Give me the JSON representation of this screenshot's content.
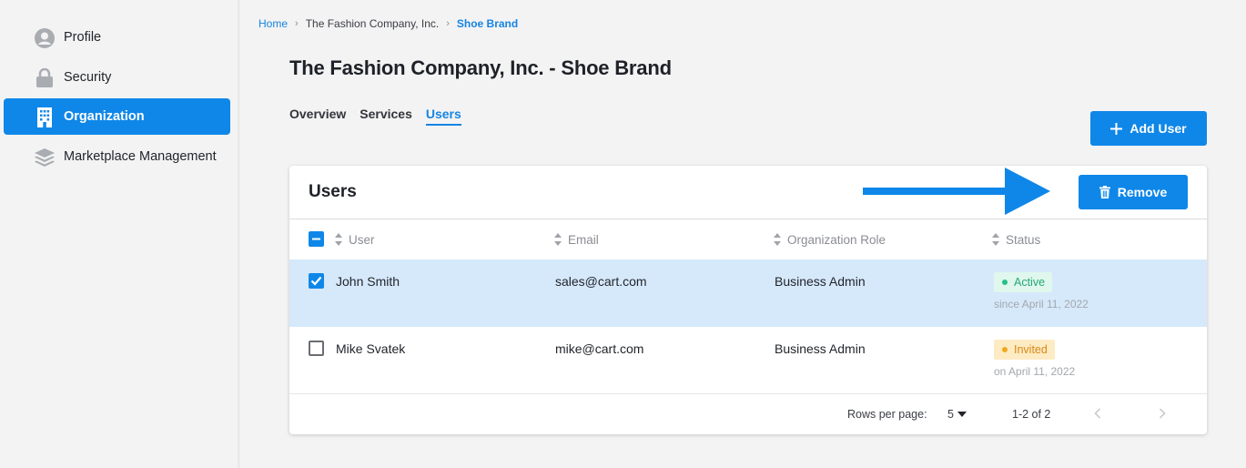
{
  "sidebar": {
    "items": [
      {
        "label": "Profile",
        "icon": "user-circle-icon"
      },
      {
        "label": "Security",
        "icon": "lock-icon"
      },
      {
        "label": "Organization",
        "icon": "building-icon",
        "active": true
      },
      {
        "label": "Marketplace Management",
        "icon": "layers-icon"
      }
    ]
  },
  "breadcrumb": {
    "home": "Home",
    "company": "The Fashion Company, Inc.",
    "current": "Shoe Brand",
    "separator": "›"
  },
  "page": {
    "title": "The Fashion Company, Inc. - Shoe Brand"
  },
  "tabs": [
    {
      "label": "Overview"
    },
    {
      "label": "Services"
    },
    {
      "label": "Users",
      "active": true
    }
  ],
  "actions": {
    "add_user": "Add User",
    "remove": "Remove"
  },
  "users_card": {
    "title": "Users",
    "columns": [
      "User",
      "Email",
      "Organization Role",
      "Status"
    ],
    "rows": [
      {
        "user": "John Smith",
        "email": "sales@cart.com",
        "role": "Business Admin",
        "status": "Active",
        "status_note": "since April 11, 2022",
        "selected": true
      },
      {
        "user": "Mike Svatek",
        "email": "mike@cart.com",
        "role": "Business Admin",
        "status": "Invited",
        "status_note": "on April 11, 2022",
        "selected": false
      }
    ],
    "footer": {
      "rows_per_page_label": "Rows per page:",
      "rows_per_page_value": "5",
      "range": "1-2 of 2"
    }
  },
  "colors": {
    "accent": "#0f87e8",
    "selected_row": "#d6e9fb",
    "active_badge": "#23a875",
    "invited_badge": "#d88a14"
  }
}
